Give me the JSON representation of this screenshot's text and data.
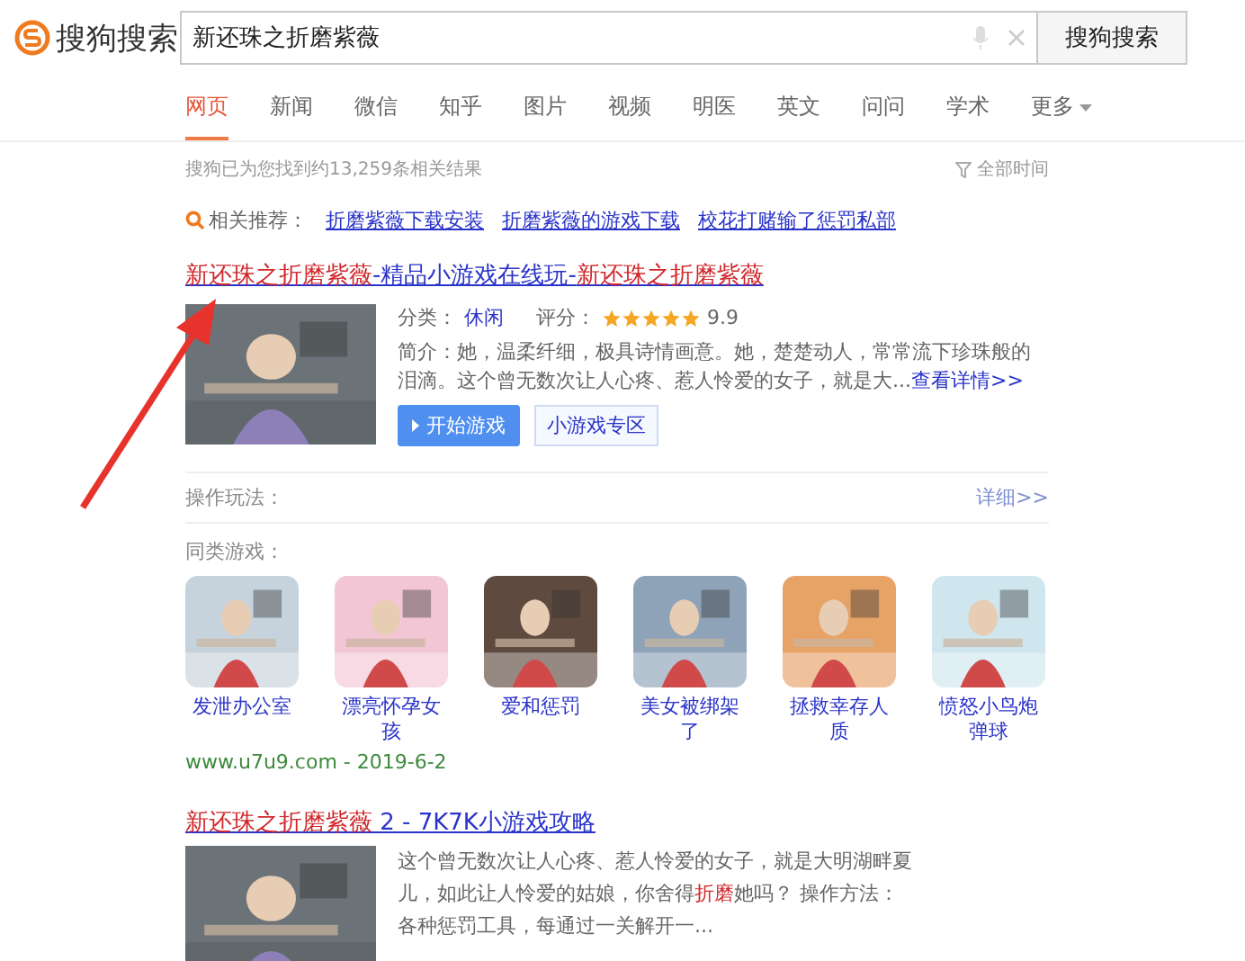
{
  "header": {
    "logo_text": "搜狗搜索",
    "query": "新还珠之折磨紫薇",
    "search_button": "搜狗搜索"
  },
  "tabs": [
    {
      "label": "网页",
      "selected": true
    },
    {
      "label": "新闻",
      "selected": false
    },
    {
      "label": "微信",
      "selected": false
    },
    {
      "label": "知乎",
      "selected": false
    },
    {
      "label": "图片",
      "selected": false
    },
    {
      "label": "视频",
      "selected": false
    },
    {
      "label": "明医",
      "selected": false
    },
    {
      "label": "英文",
      "selected": false
    },
    {
      "label": "问问",
      "selected": false
    },
    {
      "label": "学术",
      "selected": false
    },
    {
      "label": "更多",
      "selected": false,
      "dropdown": true
    }
  ],
  "result_count": "搜狗已为您找到约13,259条相关结果",
  "time_filter": "全部时间",
  "related": {
    "label": "相关推荐：",
    "links": [
      "折磨紫薇下载安装",
      "折磨紫薇的游戏下载",
      "校花打赌输了惩罚私部"
    ]
  },
  "results": [
    {
      "kind": "game",
      "title": [
        {
          "text": "新还珠之折磨紫薇",
          "highlight": true
        },
        {
          "text": "-精品小游戏在线玩-",
          "highlight": false
        },
        {
          "text": "新还珠之折磨紫薇",
          "highlight": true
        }
      ],
      "category_label": "分类：",
      "category": "休闲",
      "rating_label": "评分：",
      "stars": 5,
      "score": "9.9",
      "intro": "简介：她，温柔纤细，极具诗情画意。她，楚楚动人，常常流下珍珠般的泪滴。这个曾无数次让人心疼、惹人怜爱的女子，就是大...",
      "more_link": "查看详情>>",
      "play_button": "开始游戏",
      "zone_button": "小游戏专区",
      "howto_label": "操作玩法：",
      "howto_link": "详细>>",
      "similar_label": "同类游戏：",
      "similar": [
        "发泄办公室",
        "漂亮怀孕女孩",
        "爱和惩罚",
        "美女被绑架了",
        "拯救幸存人质",
        "愤怒小鸟炮弹球"
      ],
      "url": "www.u7u9.com - 2019-6-2"
    },
    {
      "kind": "text",
      "title": [
        {
          "text": "新还珠之折磨紫薇",
          "highlight": true
        },
        {
          "text": " 2 - 7K7K小游戏攻略",
          "highlight": false
        }
      ],
      "lines": [
        [
          {
            "text": "这个曾无数次让人心疼、惹人怜爱的女子，就是大明湖畔夏",
            "highlight": false
          }
        ],
        [
          {
            "text": "儿，如此让人怜爱的姑娘，你舍得",
            "highlight": false
          },
          {
            "text": "折磨",
            "highlight": true
          },
          {
            "text": "她吗？ 操作方法：",
            "highlight": false
          }
        ],
        [
          {
            "text": "各种惩罚工具，每通过一关解开一...",
            "highlight": false
          }
        ]
      ]
    }
  ]
}
